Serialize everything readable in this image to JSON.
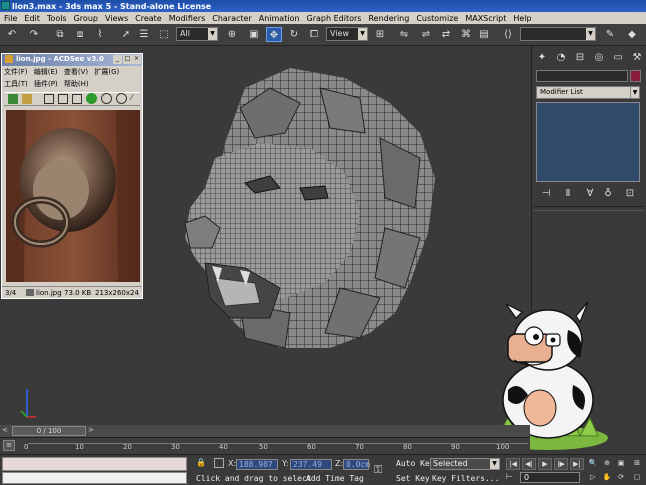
{
  "title": "lion3.max - 3ds max 5 - Stand-alone License",
  "menu": [
    "File",
    "Edit",
    "Tools",
    "Group",
    "Views",
    "Create",
    "Modifiers",
    "Character",
    "Animation",
    "Graph Editors",
    "Rendering",
    "Customize",
    "MAXScript",
    "Help"
  ],
  "toolbar": {
    "selection_filter": "All",
    "ref_coord": "View",
    "named_selection": ""
  },
  "acdsee": {
    "title": "lion.jpg - ACDSee v3.0",
    "menu_row1": [
      "文件(F)",
      "编辑(E)",
      "查看(V)",
      "扩展(G)"
    ],
    "menu_row2": [
      "工具(T)",
      "插件(P)",
      "帮助(H)"
    ],
    "status_index": "3/4",
    "status_file": "lion.jpg",
    "status_size": "73.0 KB",
    "status_dims": "213x260x24"
  },
  "command_panel": {
    "modifier_list": "Modifier List",
    "accent_color": "#8a1a3a"
  },
  "timeline": {
    "slider_label": "0 / 100",
    "ticks": [
      "0",
      "10",
      "20",
      "30",
      "40",
      "50",
      "60",
      "70",
      "80",
      "90",
      "100"
    ]
  },
  "status": {
    "x_label": "X:",
    "x_value": "188.987",
    "y_label": "Y:",
    "y_value": "237.49",
    "z_label": "Z:",
    "z_value": "0.0cm",
    "prompt": "Click and drag to select",
    "add_time_tag": "Add Time Tag",
    "auto_key": "Auto Key",
    "auto_key_value": "Selected",
    "set_key": "Set Key",
    "key_filters": "Key Filters...",
    "frame": "0"
  },
  "colors": {
    "titlebar": "#2d62c6",
    "menubar": "#d4d0c8",
    "viewport": "#3a3a3a",
    "accent": "#2a5ca8"
  }
}
